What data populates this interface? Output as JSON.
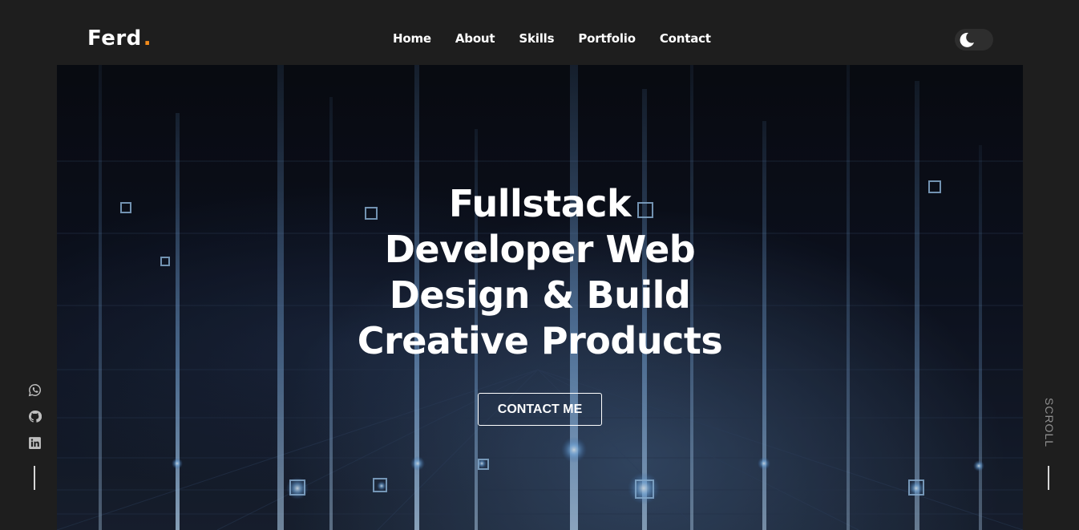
{
  "brand": {
    "name": "Ferd",
    "dot": ".",
    "dot_color": "#f28b1b"
  },
  "nav": {
    "items": [
      {
        "label": "Home"
      },
      {
        "label": "About"
      },
      {
        "label": "Skills"
      },
      {
        "label": "Portfolio"
      },
      {
        "label": "Contact"
      }
    ]
  },
  "theme_toggle": {
    "icon": "moon-icon",
    "state": "dark"
  },
  "hero": {
    "title_lines": [
      "Fullstack",
      "Developer Web",
      "Design & Build",
      "Creative Products"
    ],
    "cta_label": "CONTACT ME",
    "background": "futuristic circuit city with glowing blue light streaks"
  },
  "social": {
    "items": [
      {
        "icon": "whatsapp-icon"
      },
      {
        "icon": "github-icon"
      },
      {
        "icon": "linkedin-icon"
      }
    ]
  },
  "scroll": {
    "label": "SCROLL"
  },
  "colors": {
    "page_bg": "#1e1e1e",
    "text": "#ffffff",
    "accent": "#f28b1b",
    "muted": "#8f8f8f"
  }
}
